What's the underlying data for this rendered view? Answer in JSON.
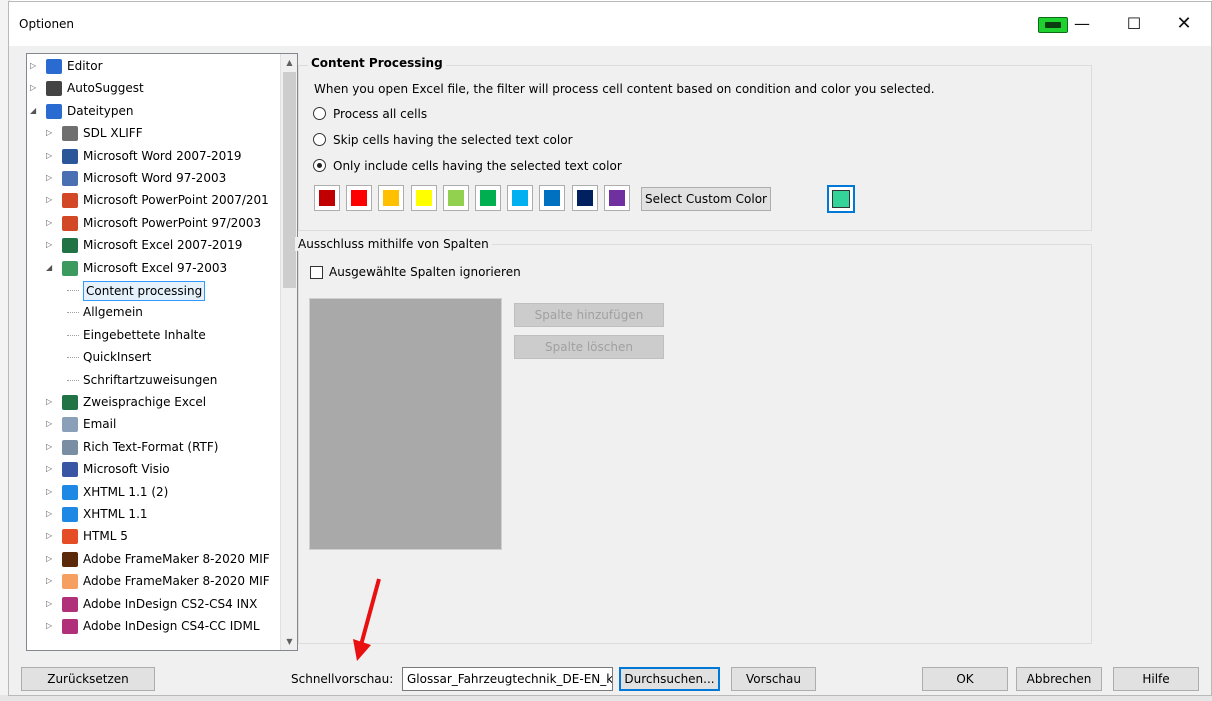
{
  "window": {
    "title": "Optionen",
    "controls": {
      "minimize": "—",
      "maximize": "☐",
      "close": "✕"
    }
  },
  "tree": {
    "items": [
      {
        "label": "Editor",
        "icon": "pencil-icon",
        "color": "#2a6bd1",
        "level": 0,
        "expanded": false
      },
      {
        "label": "AutoSuggest",
        "icon": "autosuggest-icon",
        "color": "#444444",
        "level": 0,
        "expanded": false
      },
      {
        "label": "Dateitypen",
        "icon": "filetypes-icon",
        "color": "#2a6bd1",
        "level": 0,
        "expanded": true
      },
      {
        "label": "SDL XLIFF",
        "icon": "xliff-icon",
        "color": "#6f6f6f",
        "level": 1,
        "expanded": false
      },
      {
        "label": "Microsoft Word 2007-2019",
        "icon": "word-icon",
        "color": "#2b579a",
        "level": 1,
        "expanded": false
      },
      {
        "label": "Microsoft Word 97-2003",
        "icon": "word-old-icon",
        "color": "#4a6fb3",
        "level": 1,
        "expanded": false
      },
      {
        "label": "Microsoft PowerPoint 2007/201",
        "icon": "powerpoint-icon",
        "color": "#d24726",
        "level": 1,
        "expanded": false
      },
      {
        "label": "Microsoft PowerPoint 97/2003",
        "icon": "powerpoint-old-icon",
        "color": "#d24726",
        "level": 1,
        "expanded": false
      },
      {
        "label": "Microsoft Excel 2007-2019",
        "icon": "excel-icon",
        "color": "#217346",
        "level": 1,
        "expanded": false
      },
      {
        "label": "Microsoft Excel 97-2003",
        "icon": "excel-old-icon",
        "color": "#3d9a5f",
        "level": 1,
        "expanded": true
      },
      {
        "label": "Content processing",
        "icon": "",
        "color": "",
        "level": 2,
        "selected": true
      },
      {
        "label": "Allgemein",
        "icon": "",
        "color": "",
        "level": 2
      },
      {
        "label": "Eingebettete Inhalte",
        "icon": "",
        "color": "",
        "level": 2
      },
      {
        "label": "QuickInsert",
        "icon": "",
        "color": "",
        "level": 2
      },
      {
        "label": "Schriftartzuweisungen",
        "icon": "",
        "color": "",
        "level": 2
      },
      {
        "label": "Zweisprachige Excel",
        "icon": "bilingual-excel-icon",
        "color": "#217346",
        "level": 1,
        "expanded": false
      },
      {
        "label": "Email",
        "icon": "email-icon",
        "color": "#8aa0b8",
        "level": 1,
        "expanded": false
      },
      {
        "label": "Rich Text-Format (RTF)",
        "icon": "rtf-icon",
        "color": "#7a8ea3",
        "level": 1,
        "expanded": false
      },
      {
        "label": "Microsoft Visio",
        "icon": "visio-icon",
        "color": "#3955a3",
        "level": 1,
        "expanded": false
      },
      {
        "label": "XHTML 1.1 (2)",
        "icon": "ie-icon",
        "color": "#1e88e5",
        "level": 1,
        "expanded": false
      },
      {
        "label": "XHTML 1.1",
        "icon": "ie-icon",
        "color": "#1e88e5",
        "level": 1,
        "expanded": false
      },
      {
        "label": "HTML 5",
        "icon": "html5-icon",
        "color": "#e44d26",
        "level": 1,
        "expanded": false
      },
      {
        "label": "Adobe FrameMaker 8-2020 MIF",
        "icon": "framemaker-icon",
        "color": "#5a2a0a",
        "level": 1,
        "expanded": false
      },
      {
        "label": "Adobe FrameMaker 8-2020 MIF",
        "icon": "framemaker-icon",
        "color": "#f5a060",
        "level": 1,
        "expanded": false
      },
      {
        "label": "Adobe InDesign CS2-CS4 INX",
        "icon": "indesign-icon",
        "color": "#b0307a",
        "level": 1,
        "expanded": false
      },
      {
        "label": "Adobe InDesign CS4-CC IDML",
        "icon": "indesign-icon",
        "color": "#b0307a",
        "level": 1,
        "expanded": false
      }
    ]
  },
  "content_processing": {
    "title": "Content Processing",
    "description": "When you open Excel file, the filter will process cell content based on condition and color you selected.",
    "options": [
      {
        "label": "Process all cells",
        "checked": false
      },
      {
        "label": "Skip cells having the selected text color",
        "checked": false
      },
      {
        "label": "Only include cells having the selected text color",
        "checked": true
      }
    ],
    "colors": [
      "#c00000",
      "#ff0000",
      "#ffc000",
      "#ffff00",
      "#92d050",
      "#00b050",
      "#00b0f0",
      "#0070c0",
      "#002060",
      "#7030a0"
    ],
    "custom_color_button": "Select Custom Color",
    "custom_color": "#34d399"
  },
  "exclusion": {
    "title": "Ausschluss mithilfe von Spalten",
    "checkbox_label": "Ausgewählte Spalten ignorieren",
    "checkbox_checked": false,
    "add_button": "Spalte hinzufügen",
    "delete_button": "Spalte löschen"
  },
  "footer": {
    "reset_button": "Zurücksetzen",
    "preview_label": "Schnellvorschau:",
    "preview_file": "Glossar_Fahrzeugtechnik_DE-EN_ki",
    "browse_button": "Durchsuchen...",
    "preview_button": "Vorschau",
    "ok_button": "OK",
    "cancel_button": "Abbrechen",
    "help_button": "Hilfe"
  }
}
